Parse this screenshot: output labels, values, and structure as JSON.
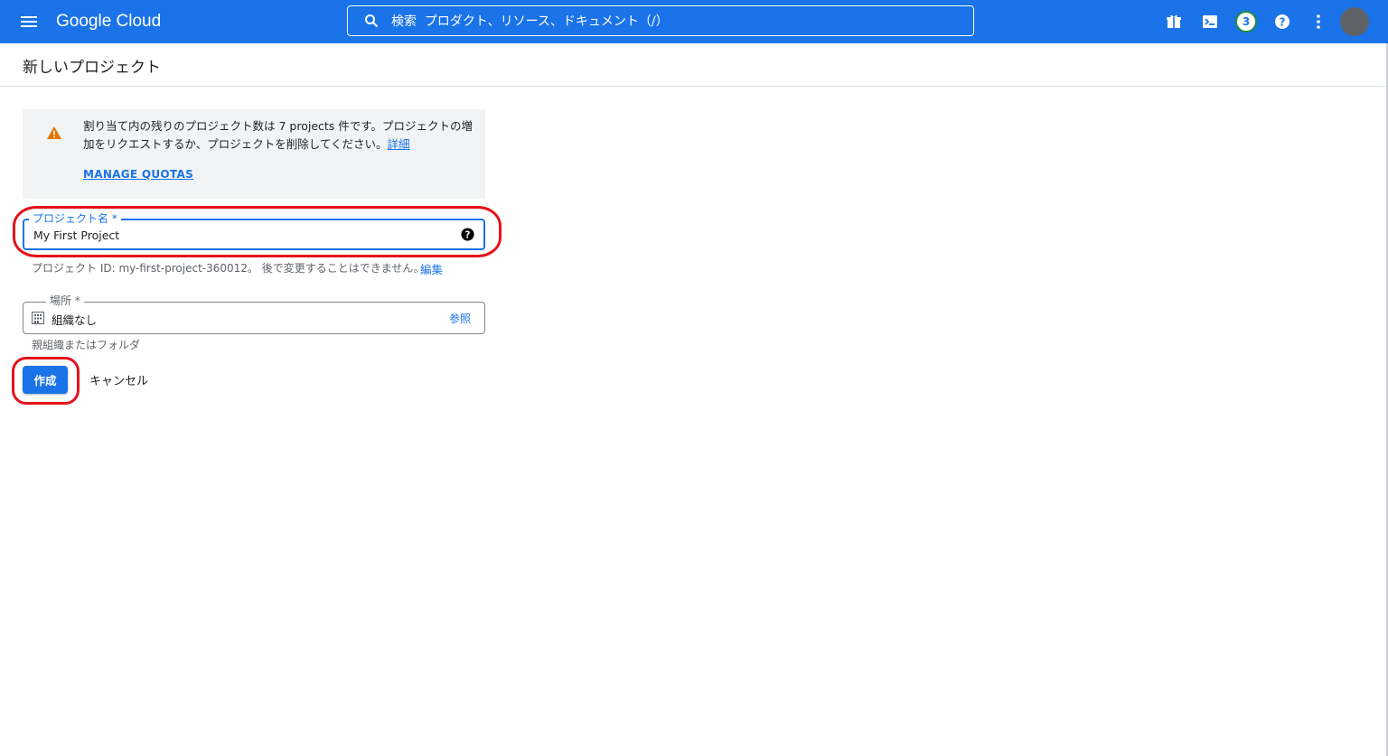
{
  "header": {
    "logo": "Google Cloud",
    "search_placeholder": "検索  プロダクト、リソース、ドキュメント（/）",
    "notification_count": "3",
    "colors": {
      "bar": "#1a73e8",
      "badge_ring": "#1e8e3e"
    }
  },
  "page": {
    "title": "新しいプロジェクト"
  },
  "quota": {
    "message": "割り当て内の残りのプロジェクト数は 7 projects 件です。プロジェクトの増加をリクエストするか、プロジェクトを削除してください。",
    "details_link": "詳細",
    "manage_link": "MANAGE QUOTAS"
  },
  "form": {
    "name_label": "プロジェクト名 *",
    "name_value": "My First Project",
    "project_id_hint": "プロジェクト ID: my-first-project-360012。 後で変更することはできません。",
    "edit_link": "編集",
    "location_label": "場所 *",
    "location_value": "組織なし",
    "browse_link": "参照",
    "location_hint": "親組織またはフォルダ",
    "create_button": "作成",
    "cancel_button": "キャンセル"
  },
  "icons": {
    "menu": "menu-icon",
    "search": "search-icon",
    "gift": "gift-icon",
    "terminal": "cloud-shell-icon",
    "help": "help-icon",
    "more": "more-vert-icon",
    "warning": "warning-icon",
    "building": "building-icon"
  },
  "annotations": {
    "highlight_color": "#e3131b"
  }
}
